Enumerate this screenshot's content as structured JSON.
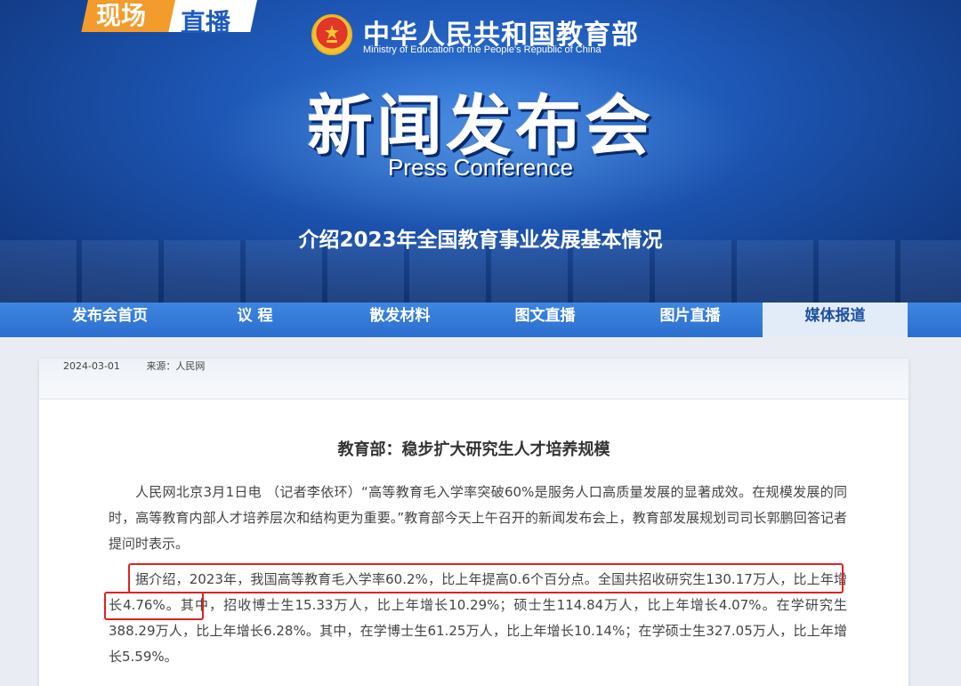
{
  "banner": {
    "badge_left": "现场",
    "badge_right": "直播",
    "ministry_cn": "中华人民共和国教育部",
    "ministry_en": "Ministry of Education of the People's Republic of China",
    "title_cn": "新闻发布会",
    "title_en": "Press Conference",
    "subtitle": "介绍2023年全国教育事业发展基本情况"
  },
  "nav": {
    "items": [
      {
        "label": "发布会首页"
      },
      {
        "label": "议 程"
      },
      {
        "label": "散发材料"
      },
      {
        "label": "图文直播"
      },
      {
        "label": "图片直播"
      },
      {
        "label": "媒体报道"
      }
    ],
    "active": "媒体报道"
  },
  "article": {
    "date": "2024-03-01",
    "source": "来源：人民网",
    "title": "教育部：稳步扩大研究生人才培养规模",
    "paragraphs": [
      "人民网北京3月1日电 （记者李依环）“高等教育毛入学率突破60%是服务人口高质量发展的显著成效。在规模发展的同时，高等教育内部人才培养层次和结构更为重要。”教育部今天上午召开的新闻发布会上，教育部发展规划司司长郭鹏回答记者提问时表示。",
      "据介绍，2023年，我国高等教育毛入学率60.2%，比上年提高0.6个百分点。全国共招收研究生130.17万人，比上年增长4.76%。其中，招收博士生15.33万人，比上年增长10.29%；硕士生114.84万人，比上年增长4.07%。在学研究生388.29万人，比上年增长6.28%。其中，在学博士生61.25万人，比上年增长10.14%；在学硕士生327.05万人，比上年增长5.59%。"
    ]
  },
  "colors": {
    "banner_blue": "#1d56b4",
    "nav_blue": "#2c6fcf",
    "active_tab_bg": "#e2ecf9",
    "highlight_red": "#e02222",
    "badge_orange": "#f39b2c"
  }
}
